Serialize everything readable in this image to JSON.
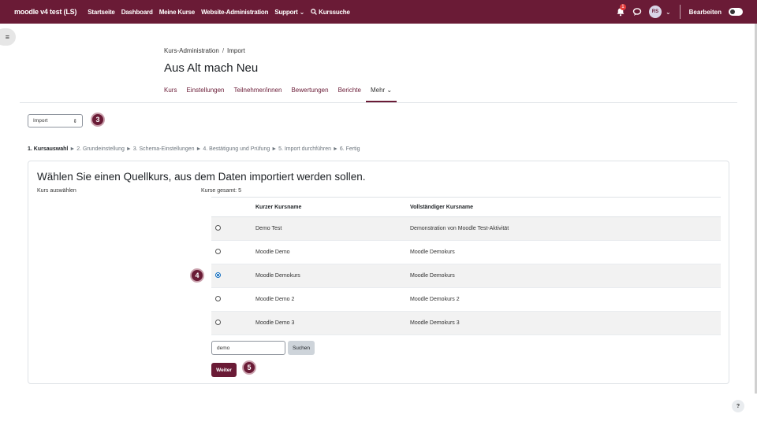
{
  "navbar": {
    "brand": "moodle v4 test (LS)",
    "links": [
      "Startseite",
      "Dashboard",
      "Meine Kurse",
      "Website-Administration",
      "Support"
    ],
    "search_label": "Kurssuche",
    "notification_count": "1",
    "avatar_initials": "RS",
    "edit_mode_label": "Bearbeiten",
    "bg_color": "#6a1b36"
  },
  "header": {
    "breadcrumb": [
      "Kurs-Administration",
      "Import"
    ],
    "title": "Aus Alt mach Neu",
    "tabs": [
      "Kurs",
      "Einstellungen",
      "Teilnehmer/innen",
      "Bewertungen",
      "Berichte",
      "Mehr"
    ],
    "active_tab": "Mehr"
  },
  "import_select": {
    "value": "Import"
  },
  "badges": {
    "select": "3",
    "row": "4",
    "next": "5"
  },
  "stages": {
    "current": "1. Kursauswahl",
    "rest": [
      "2. Grundeinstellung",
      "3. Schema-Einstellungen",
      "4. Bestätigung und Prüfung",
      "5. Import durchführen",
      "6. Fertig"
    ]
  },
  "card": {
    "heading": "Wählen Sie einen Quellkurs, aus dem Daten importiert werden sollen.",
    "select_label": "Kurs auswählen",
    "total_label": "Kurse gesamt: 5",
    "columns": {
      "short": "Kurzer Kursname",
      "full": "Vollständiger Kursname"
    },
    "rows": [
      {
        "short": "Demo Test",
        "full": "Demonstration von Moodle Test-Aktivität",
        "checked": false
      },
      {
        "short": "Moodle Demo",
        "full": "Moodle Demokurs",
        "checked": false
      },
      {
        "short": "Moodle Demokurs",
        "full": "Moodle Demokurs",
        "checked": true
      },
      {
        "short": "Moodle Demo 2",
        "full": "Moodle Demokurs 2",
        "checked": false
      },
      {
        "short": "Moodle Demo 3",
        "full": "Moodle Demokurs 3",
        "checked": false
      }
    ],
    "search_value": "demo",
    "search_button": "Suchen",
    "next_button": "Weiter"
  },
  "help_label": "?"
}
